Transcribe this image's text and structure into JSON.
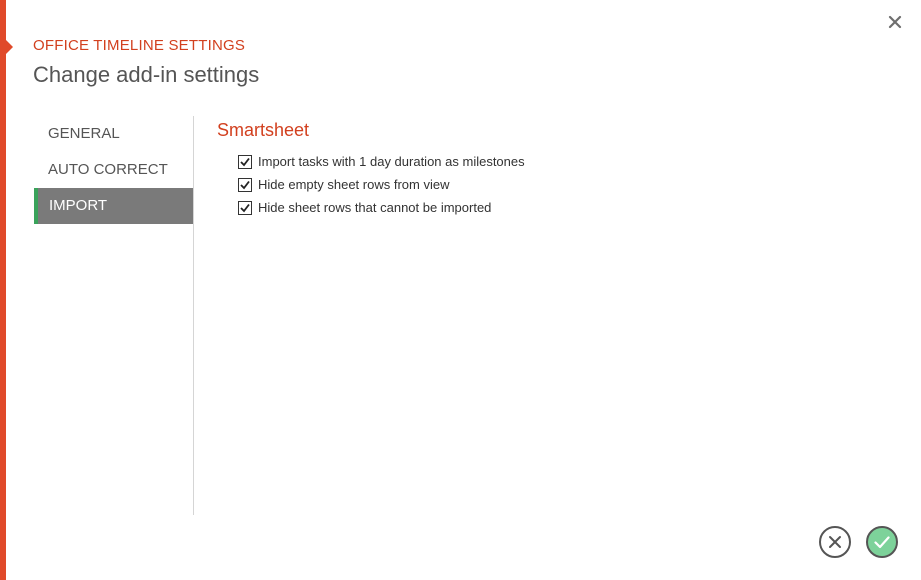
{
  "dialog": {
    "kicker": "OFFICE TIMELINE SETTINGS",
    "title": "Change add-in settings"
  },
  "sidebar": {
    "items": [
      {
        "label": "GENERAL",
        "active": false
      },
      {
        "label": "AUTO CORRECT",
        "active": false
      },
      {
        "label": "IMPORT",
        "active": true
      }
    ]
  },
  "main": {
    "section_title": "Smartsheet",
    "options": [
      {
        "label": "Import tasks with 1 day duration as milestones",
        "checked": true
      },
      {
        "label": "Hide empty sheet rows from view",
        "checked": true
      },
      {
        "label": "Hide sheet rows that cannot be imported",
        "checked": true
      }
    ]
  },
  "colors": {
    "accent": "#e04a2a",
    "active_tab": "#7a7a7a",
    "active_marker": "#3aa35b",
    "ok": "#7dd29a"
  },
  "icons": {
    "close": "close-icon",
    "cancel": "cancel-circle-icon",
    "ok": "check-circle-icon"
  }
}
